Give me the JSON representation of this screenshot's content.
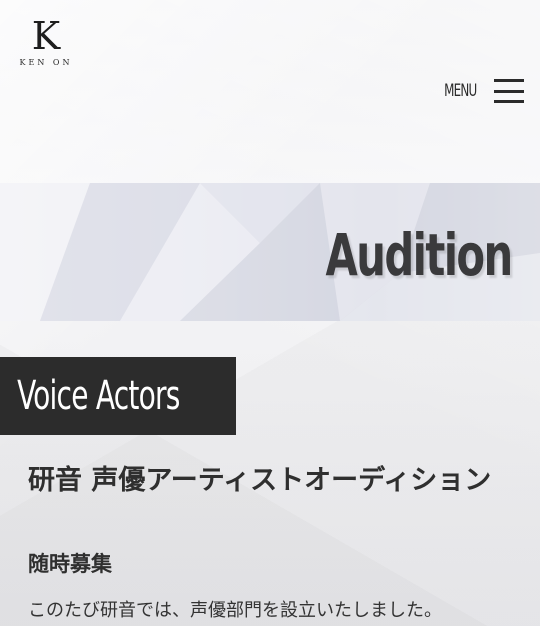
{
  "header": {
    "logo_mark": "K",
    "logo_text": "KEN ON",
    "menu_label": "MENU",
    "menu_icon": "hamburger-icon"
  },
  "banner": {
    "title": "Audition"
  },
  "section": {
    "label": "Voice Actors"
  },
  "article": {
    "title": "研音 声優アーティストオーディション",
    "subtitle": "随時募集",
    "body": "このたび研音では、声優部門を設立いたしました。"
  }
}
